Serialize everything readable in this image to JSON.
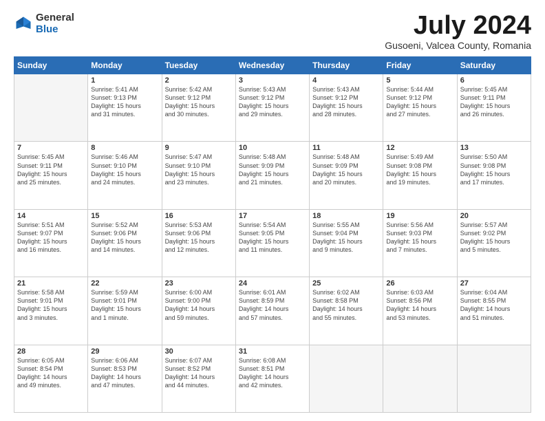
{
  "header": {
    "logo_general": "General",
    "logo_blue": "Blue",
    "month_title": "July 2024",
    "location": "Gusoeni, Valcea County, Romania"
  },
  "weekdays": [
    "Sunday",
    "Monday",
    "Tuesday",
    "Wednesday",
    "Thursday",
    "Friday",
    "Saturday"
  ],
  "weeks": [
    [
      {
        "num": "",
        "info": ""
      },
      {
        "num": "1",
        "info": "Sunrise: 5:41 AM\nSunset: 9:13 PM\nDaylight: 15 hours\nand 31 minutes."
      },
      {
        "num": "2",
        "info": "Sunrise: 5:42 AM\nSunset: 9:12 PM\nDaylight: 15 hours\nand 30 minutes."
      },
      {
        "num": "3",
        "info": "Sunrise: 5:43 AM\nSunset: 9:12 PM\nDaylight: 15 hours\nand 29 minutes."
      },
      {
        "num": "4",
        "info": "Sunrise: 5:43 AM\nSunset: 9:12 PM\nDaylight: 15 hours\nand 28 minutes."
      },
      {
        "num": "5",
        "info": "Sunrise: 5:44 AM\nSunset: 9:12 PM\nDaylight: 15 hours\nand 27 minutes."
      },
      {
        "num": "6",
        "info": "Sunrise: 5:45 AM\nSunset: 9:11 PM\nDaylight: 15 hours\nand 26 minutes."
      }
    ],
    [
      {
        "num": "7",
        "info": "Sunrise: 5:45 AM\nSunset: 9:11 PM\nDaylight: 15 hours\nand 25 minutes."
      },
      {
        "num": "8",
        "info": "Sunrise: 5:46 AM\nSunset: 9:10 PM\nDaylight: 15 hours\nand 24 minutes."
      },
      {
        "num": "9",
        "info": "Sunrise: 5:47 AM\nSunset: 9:10 PM\nDaylight: 15 hours\nand 23 minutes."
      },
      {
        "num": "10",
        "info": "Sunrise: 5:48 AM\nSunset: 9:09 PM\nDaylight: 15 hours\nand 21 minutes."
      },
      {
        "num": "11",
        "info": "Sunrise: 5:48 AM\nSunset: 9:09 PM\nDaylight: 15 hours\nand 20 minutes."
      },
      {
        "num": "12",
        "info": "Sunrise: 5:49 AM\nSunset: 9:08 PM\nDaylight: 15 hours\nand 19 minutes."
      },
      {
        "num": "13",
        "info": "Sunrise: 5:50 AM\nSunset: 9:08 PM\nDaylight: 15 hours\nand 17 minutes."
      }
    ],
    [
      {
        "num": "14",
        "info": "Sunrise: 5:51 AM\nSunset: 9:07 PM\nDaylight: 15 hours\nand 16 minutes."
      },
      {
        "num": "15",
        "info": "Sunrise: 5:52 AM\nSunset: 9:06 PM\nDaylight: 15 hours\nand 14 minutes."
      },
      {
        "num": "16",
        "info": "Sunrise: 5:53 AM\nSunset: 9:06 PM\nDaylight: 15 hours\nand 12 minutes."
      },
      {
        "num": "17",
        "info": "Sunrise: 5:54 AM\nSunset: 9:05 PM\nDaylight: 15 hours\nand 11 minutes."
      },
      {
        "num": "18",
        "info": "Sunrise: 5:55 AM\nSunset: 9:04 PM\nDaylight: 15 hours\nand 9 minutes."
      },
      {
        "num": "19",
        "info": "Sunrise: 5:56 AM\nSunset: 9:03 PM\nDaylight: 15 hours\nand 7 minutes."
      },
      {
        "num": "20",
        "info": "Sunrise: 5:57 AM\nSunset: 9:02 PM\nDaylight: 15 hours\nand 5 minutes."
      }
    ],
    [
      {
        "num": "21",
        "info": "Sunrise: 5:58 AM\nSunset: 9:01 PM\nDaylight: 15 hours\nand 3 minutes."
      },
      {
        "num": "22",
        "info": "Sunrise: 5:59 AM\nSunset: 9:01 PM\nDaylight: 15 hours\nand 1 minute."
      },
      {
        "num": "23",
        "info": "Sunrise: 6:00 AM\nSunset: 9:00 PM\nDaylight: 14 hours\nand 59 minutes."
      },
      {
        "num": "24",
        "info": "Sunrise: 6:01 AM\nSunset: 8:59 PM\nDaylight: 14 hours\nand 57 minutes."
      },
      {
        "num": "25",
        "info": "Sunrise: 6:02 AM\nSunset: 8:58 PM\nDaylight: 14 hours\nand 55 minutes."
      },
      {
        "num": "26",
        "info": "Sunrise: 6:03 AM\nSunset: 8:56 PM\nDaylight: 14 hours\nand 53 minutes."
      },
      {
        "num": "27",
        "info": "Sunrise: 6:04 AM\nSunset: 8:55 PM\nDaylight: 14 hours\nand 51 minutes."
      }
    ],
    [
      {
        "num": "28",
        "info": "Sunrise: 6:05 AM\nSunset: 8:54 PM\nDaylight: 14 hours\nand 49 minutes."
      },
      {
        "num": "29",
        "info": "Sunrise: 6:06 AM\nSunset: 8:53 PM\nDaylight: 14 hours\nand 47 minutes."
      },
      {
        "num": "30",
        "info": "Sunrise: 6:07 AM\nSunset: 8:52 PM\nDaylight: 14 hours\nand 44 minutes."
      },
      {
        "num": "31",
        "info": "Sunrise: 6:08 AM\nSunset: 8:51 PM\nDaylight: 14 hours\nand 42 minutes."
      },
      {
        "num": "",
        "info": ""
      },
      {
        "num": "",
        "info": ""
      },
      {
        "num": "",
        "info": ""
      }
    ]
  ]
}
